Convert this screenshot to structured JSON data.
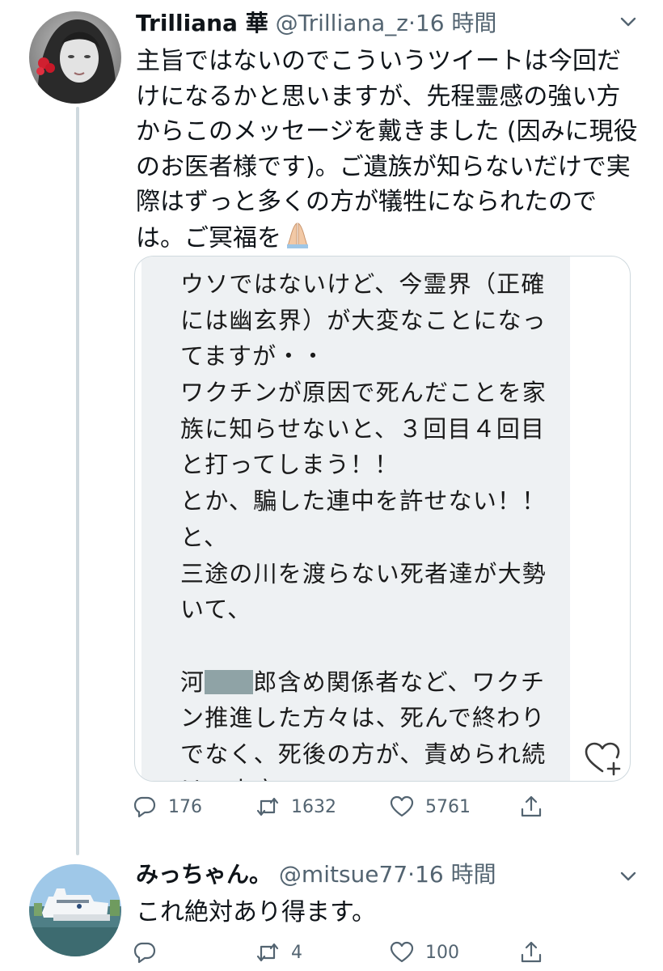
{
  "tweet": {
    "display_name": "Trilliana 華",
    "handle": "@Trilliana_z",
    "separator": "·",
    "time": "16 時間",
    "lines": [
      "主旨ではないのでこういうツイートは今回だ",
      "けになるかと思いますが、先程霊感の強い方",
      "からこのメッセージを戴きました (因みに現役",
      "のお医者様です)。ご遺族が知らないだけで実",
      "際はずっと多くの方が犠牲になられたので",
      "は。ご冥福を"
    ],
    "emoji": "folded-hands",
    "card_lines": [
      "ウソではないけど、今霊界（正確",
      "には幽玄界）が大変なことになっ",
      "てますが・・",
      "ワクチンが原因で死んだことを家",
      "族に知らせないと、３回目４回目",
      "と打ってしまう！！",
      "とか、騙した連中を許せない！！",
      "と、",
      "三途の川を渡らない死者達が大勢",
      "いて、",
      "",
      "",
      "ン推進した方々は、死んで終わり",
      "でなく、死後の方が、責められ続",
      "けて大変・・"
    ],
    "card_redacted_line": {
      "before": "河",
      "after": "郎含め関係者など、ワクチ"
    },
    "stats": {
      "replies": "176",
      "retweets": "1632",
      "likes": "5761"
    }
  },
  "reply": {
    "display_name": "みっちゃん。",
    "handle": "@mitsue77",
    "separator": "·",
    "time": "16 時間",
    "text": "これ絶対あり得ます。",
    "stats": {
      "replies": "",
      "retweets": "4",
      "likes": "100"
    }
  },
  "colors": {
    "text": "#0f1419",
    "secondary": "#536471",
    "border": "#cfd9de",
    "card_bg": "#eef1f3"
  },
  "icons": [
    "reply-icon",
    "retweet-icon",
    "like-icon",
    "share-icon",
    "chevron-down-icon",
    "heart-plus-icon"
  ]
}
